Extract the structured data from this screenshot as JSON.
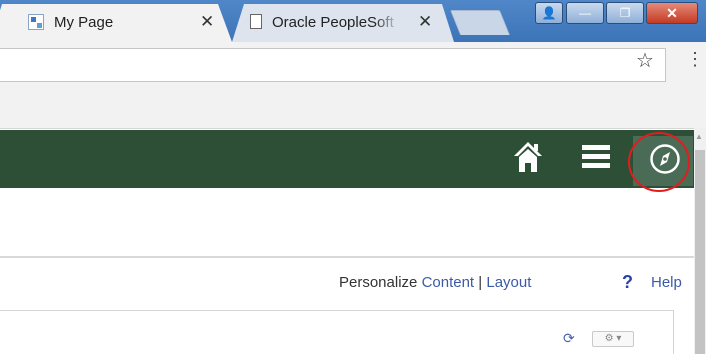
{
  "browser": {
    "tabs": [
      {
        "title": "My Page",
        "close": "✕"
      },
      {
        "title": "Oracle PeopleSoft",
        "close": "✕"
      }
    ],
    "window_controls": {
      "user": "👤",
      "minimize": "—",
      "maximize": "❐",
      "close": "✕"
    },
    "toolbar": {
      "star": "☆",
      "menu": "⋮"
    }
  },
  "header": {
    "icons": [
      "home-icon",
      "navbar-menu-icon",
      "compass-icon"
    ],
    "bar_color": "#2c4f36",
    "annotation_color": "#e01e1e"
  },
  "personalize": {
    "label": "Personalize",
    "content_link": "Content",
    "separator": "|",
    "layout_link": "Layout"
  },
  "help": {
    "icon": "?",
    "label": "Help"
  },
  "pagelet": {
    "refresh": "⟳",
    "settings": "⚙ ▾"
  }
}
